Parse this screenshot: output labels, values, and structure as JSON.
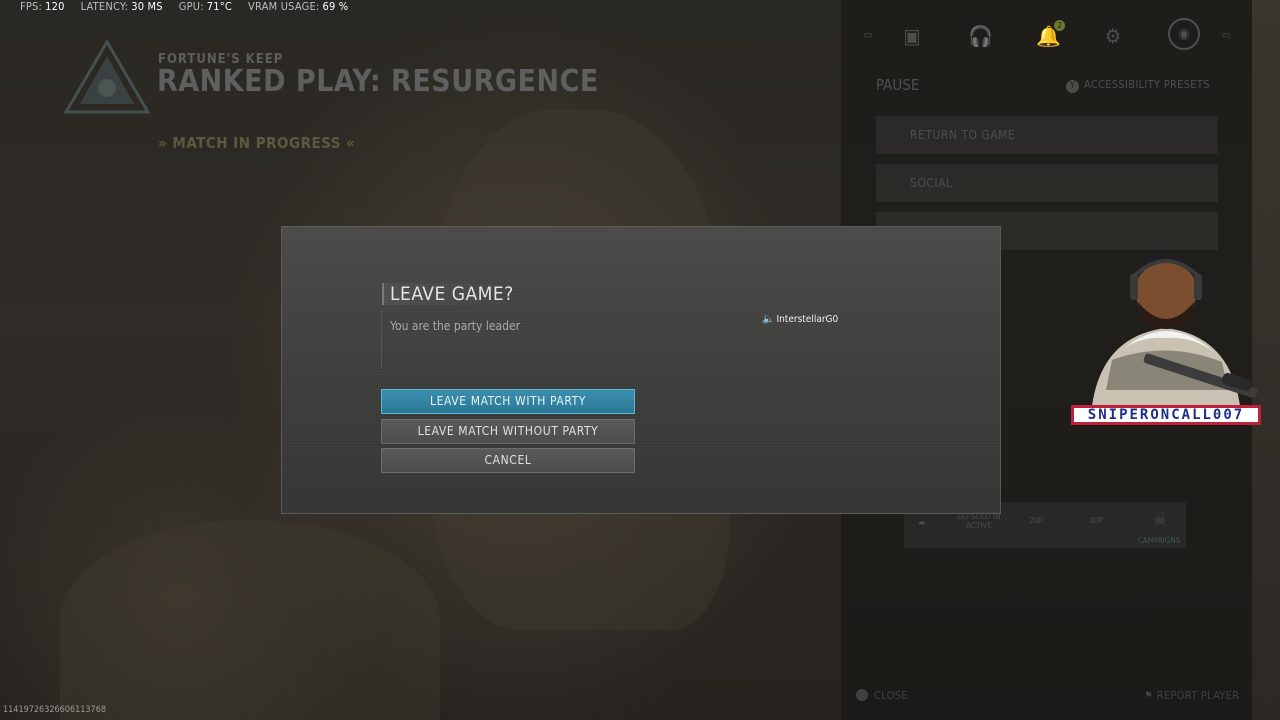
{
  "stats": {
    "fps_label": "FPS:",
    "fps_value": "120",
    "latency_label": "LATENCY:",
    "latency_value": "30 MS",
    "gpu_label": "GPU:",
    "gpu_value": "71°C",
    "vram_label": "VRAM USAGE:",
    "vram_value": "69 %"
  },
  "header": {
    "map": "FORTUNE'S KEEP",
    "mode": "RANKED PLAY: RESURGENCE",
    "status": "MATCH IN PROGRESS"
  },
  "pause_menu": {
    "title": "PAUSE",
    "accessibility_button": "Y",
    "accessibility": "ACCESSIBILITY PRESETS",
    "notification_count": "2",
    "items": [
      {
        "label": "RETURN TO GAME"
      },
      {
        "label": "SOCIAL"
      },
      {
        "label": ""
      }
    ],
    "tray": [
      {
        "label": "GO SOLO IN ACTIVE"
      },
      {
        "label": "20P"
      },
      {
        "label": "00P"
      },
      {
        "label": "CAMPAIGNS"
      }
    ],
    "close": "CLOSE",
    "report": "REPORT PLAYER"
  },
  "dialog": {
    "title": "LEAVE GAME?",
    "message": "You are the party leader",
    "player": "InterstellarG0",
    "buttons": {
      "leave_with_party": "LEAVE MATCH WITH PARTY",
      "leave_without_party": "LEAVE MATCH WITHOUT PARTY",
      "cancel": "CANCEL"
    }
  },
  "overlay": {
    "streamer_name": "SNIPERONCALL007"
  },
  "match_id": "11419726326606113768",
  "colors": {
    "primary_button": "#2f82a1",
    "nameplate_border": "#c0203a",
    "nameplate_text": "#1c2f8a"
  }
}
